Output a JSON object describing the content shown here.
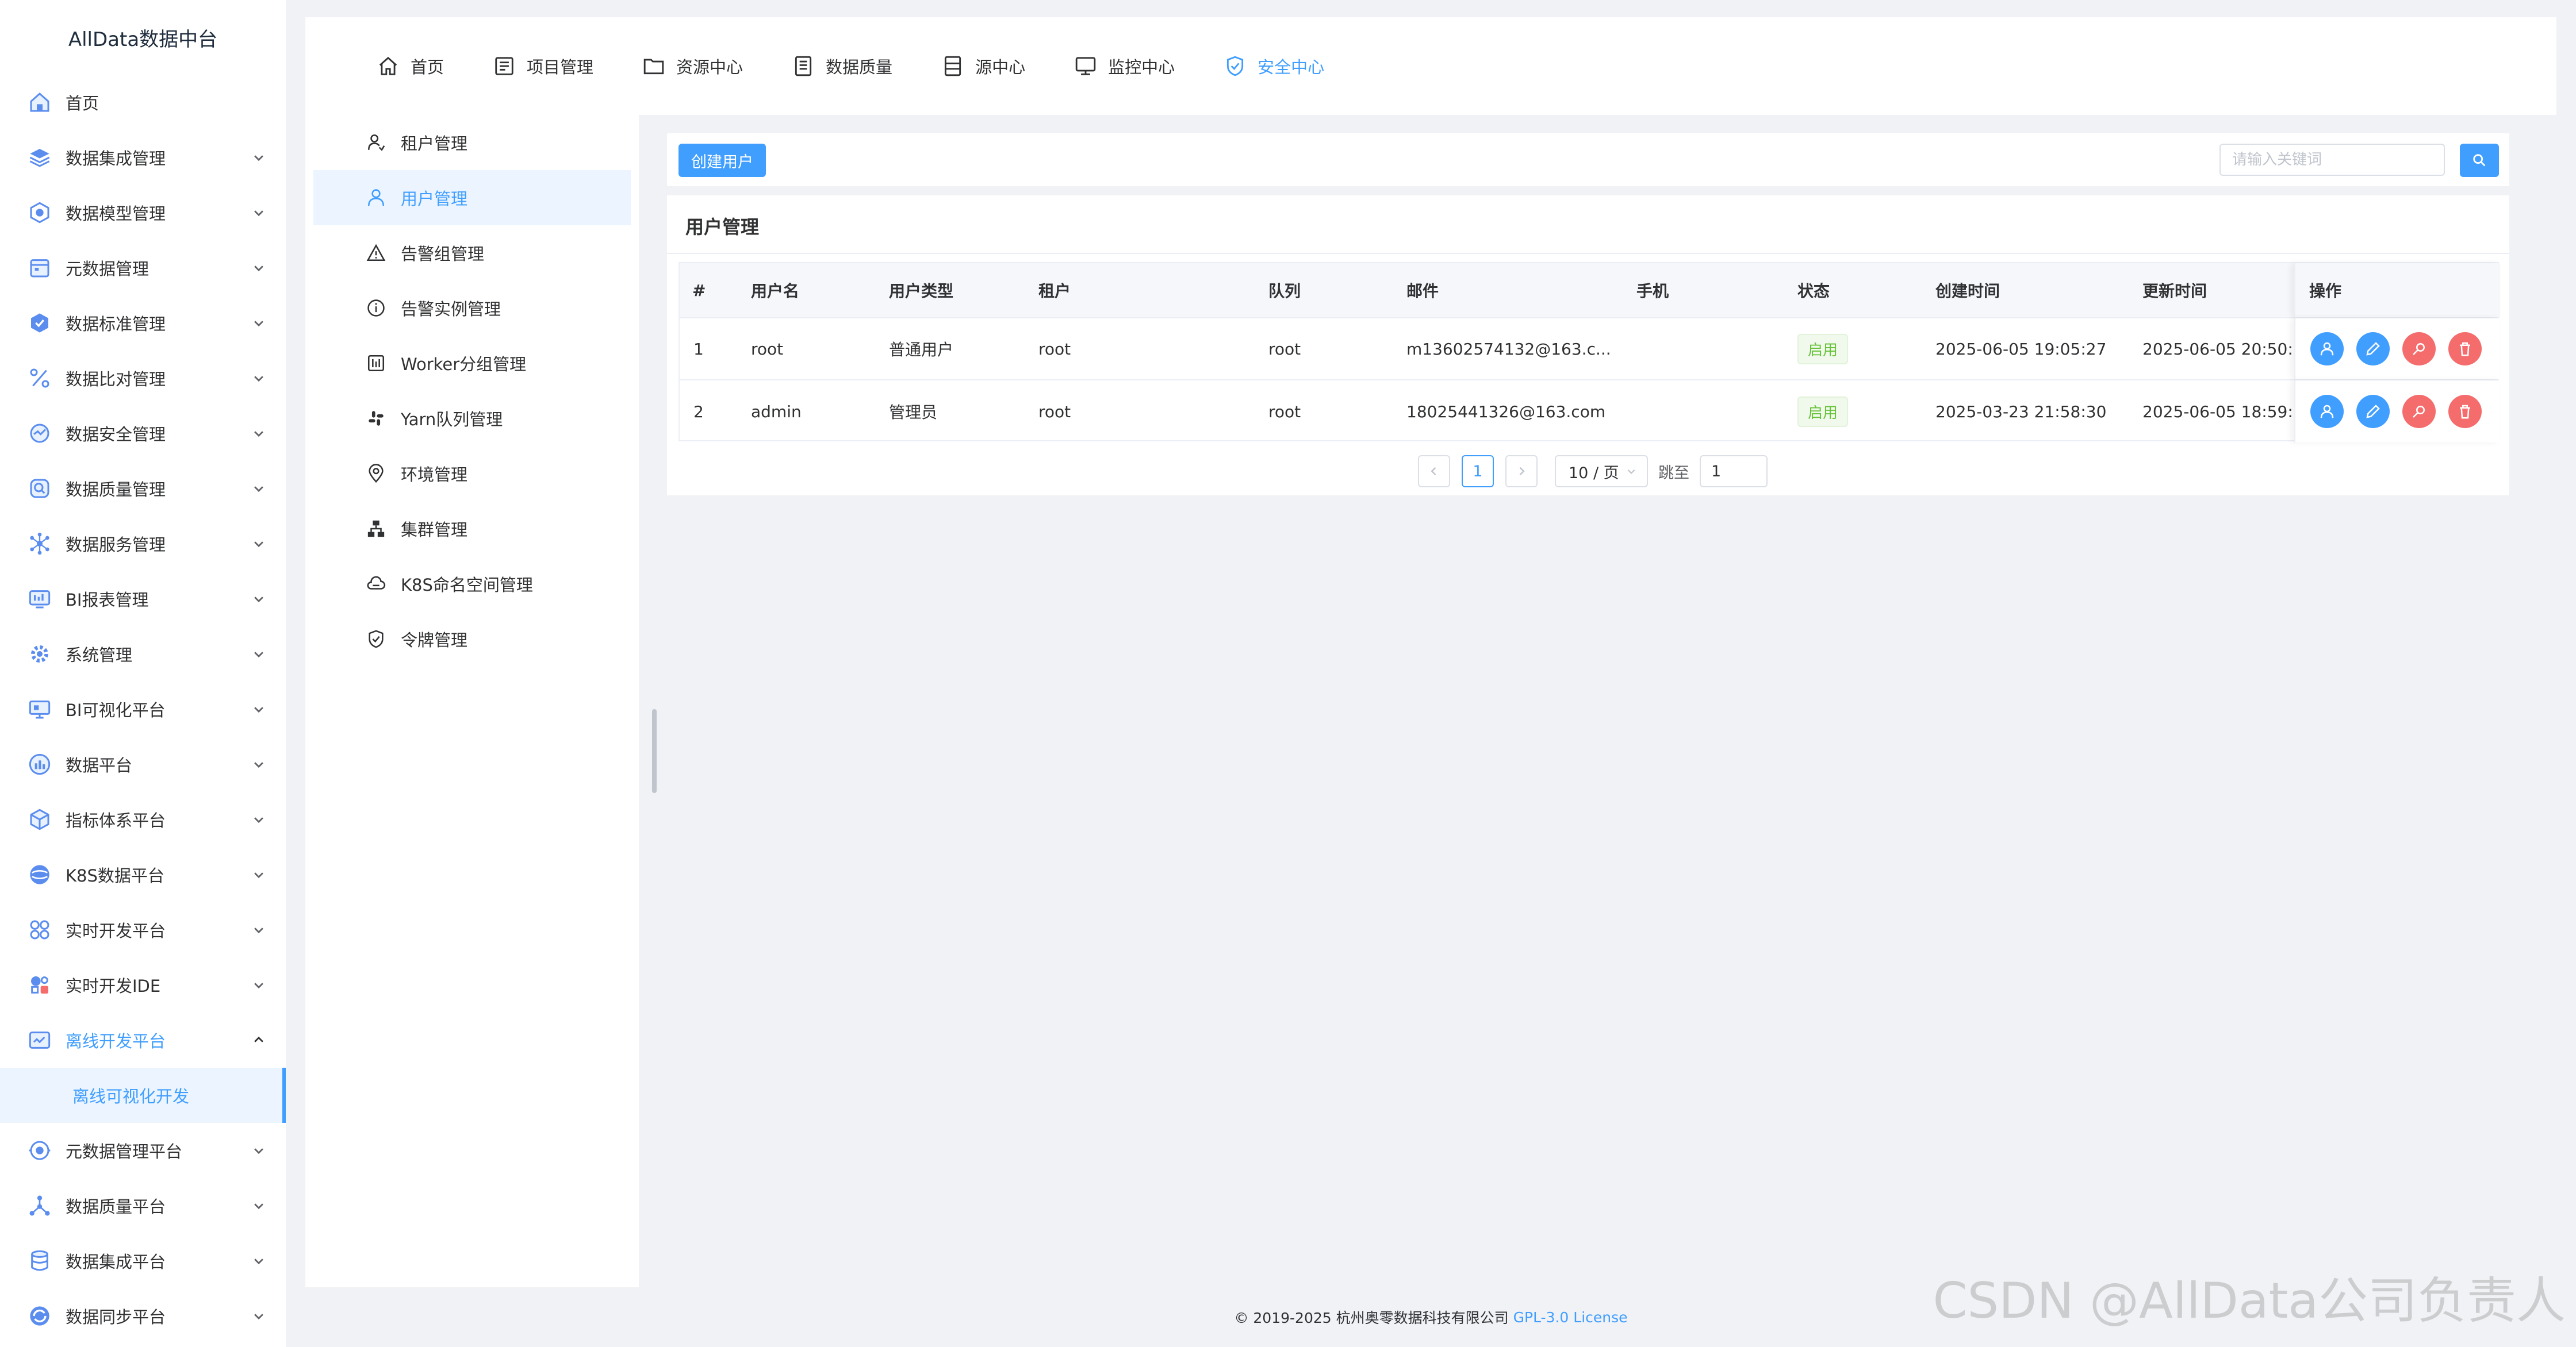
{
  "app": {
    "brand": "AllData数据中台"
  },
  "sidebar": {
    "items": [
      {
        "label": "首页",
        "icon": "home-icon"
      },
      {
        "label": "数据集成管理",
        "icon": "layers-icon"
      },
      {
        "label": "数据模型管理",
        "icon": "model-icon"
      },
      {
        "label": "元数据管理",
        "icon": "calendar-icon"
      },
      {
        "label": "数据标准管理",
        "icon": "standard-icon"
      },
      {
        "label": "数据比对管理",
        "icon": "percent-icon"
      },
      {
        "label": "数据安全管理",
        "icon": "security-icon"
      },
      {
        "label": "数据质量管理",
        "icon": "quality-icon"
      },
      {
        "label": "数据服务管理",
        "icon": "service-icon"
      },
      {
        "label": "BI报表管理",
        "icon": "report-icon"
      },
      {
        "label": "系统管理",
        "icon": "gear-icon"
      },
      {
        "label": "BI可视化平台",
        "icon": "monitor-icon"
      },
      {
        "label": "数据平台",
        "icon": "chart-icon"
      },
      {
        "label": "指标体系平台",
        "icon": "cube-icon"
      },
      {
        "label": "K8S数据平台",
        "icon": "k8s-icon"
      },
      {
        "label": "实时开发平台",
        "icon": "realtime-icon"
      },
      {
        "label": "实时开发IDE",
        "icon": "ide-icon"
      },
      {
        "label": "离线开发平台",
        "icon": "offline-icon"
      },
      {
        "label": "元数据管理平台",
        "icon": "metadata-icon"
      },
      {
        "label": "数据质量平台",
        "icon": "nodes-icon"
      },
      {
        "label": "数据集成平台",
        "icon": "database-icon"
      },
      {
        "label": "数据同步平台",
        "icon": "sync-icon"
      }
    ],
    "sub_item": "离线可视化开发"
  },
  "topnav": {
    "items": [
      {
        "label": "首页"
      },
      {
        "label": "项目管理"
      },
      {
        "label": "资源中心"
      },
      {
        "label": "数据质量"
      },
      {
        "label": "源中心"
      },
      {
        "label": "监控中心"
      },
      {
        "label": "安全中心"
      }
    ]
  },
  "submenu": {
    "items": [
      {
        "label": "租户管理"
      },
      {
        "label": "用户管理"
      },
      {
        "label": "告警组管理"
      },
      {
        "label": "告警实例管理"
      },
      {
        "label": "Worker分组管理"
      },
      {
        "label": "Yarn队列管理"
      },
      {
        "label": "环境管理"
      },
      {
        "label": "集群管理"
      },
      {
        "label": "K8S命名空间管理"
      },
      {
        "label": "令牌管理"
      }
    ]
  },
  "toolbar": {
    "create_label": "创建用户",
    "search_placeholder": "请输入关键词"
  },
  "card": {
    "title": "用户管理"
  },
  "table": {
    "headers": [
      "#",
      "用户名",
      "用户类型",
      "租户",
      "队列",
      "邮件",
      "手机",
      "状态",
      "创建时间",
      "更新时间",
      "操作"
    ],
    "rows": [
      {
        "idx": "1",
        "username": "root",
        "type": "普通用户",
        "tenant": "root",
        "queue": "root",
        "email": "m13602574132@163.c...",
        "phone": "",
        "status": "启用",
        "created": "2025-06-05 19:05:27",
        "updated": "2025-06-05 20:50:3"
      },
      {
        "idx": "2",
        "username": "admin",
        "type": "管理员",
        "tenant": "root",
        "queue": "root",
        "email": "18025441326@163.com",
        "phone": "",
        "status": "启用",
        "created": "2025-03-23 21:58:30",
        "updated": "2025-06-05 18:59:"
      }
    ]
  },
  "pagination": {
    "current": "1",
    "page_size": "10 / 页",
    "jump_label": "跳至",
    "jump_value": "1"
  },
  "footer": {
    "copyright": "© 2019-2025 杭州奥零数据科技有限公司",
    "license": "GPL-3.0 License"
  },
  "watermark": "CSDN @AllData公司负责人",
  "colors": {
    "accent": "#409eff",
    "danger": "#f56c6c",
    "success": "#67c23a"
  }
}
